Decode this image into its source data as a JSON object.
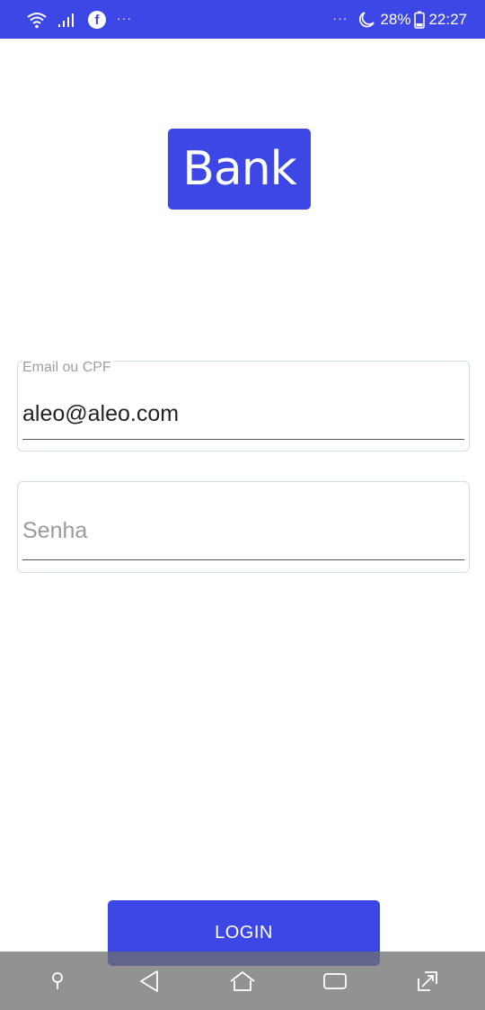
{
  "status_bar": {
    "battery": "28%",
    "time": "22:27",
    "left_more": "···",
    "right_more": "···",
    "facebook_glyph": "f",
    "icons": [
      "wifi-icon",
      "signal-icon",
      "facebook-icon",
      "moon-icon",
      "battery-icon"
    ]
  },
  "logo": {
    "text": "Bank"
  },
  "email_field": {
    "label": "Email ou CPF",
    "value": "aleo@aleo.com"
  },
  "password_field": {
    "placeholder": "Senha",
    "value": ""
  },
  "login_button": {
    "label": "LOGIN"
  },
  "nav_bar": {
    "icons": [
      "pin-icon",
      "back-icon",
      "home-icon",
      "recents-icon",
      "expand-icon"
    ]
  },
  "colors": {
    "accent": "#3d47e6",
    "field_border": "#cfdfe7",
    "nav_bar": "#6e6e6e"
  }
}
